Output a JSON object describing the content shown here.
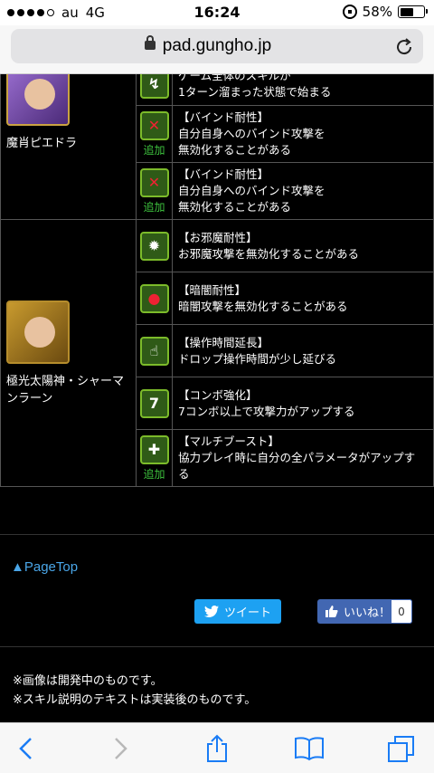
{
  "status": {
    "carrier": "au",
    "network": "4G",
    "time": "16:24",
    "battery": "58%",
    "battery_level": 0.58
  },
  "browser": {
    "url": "pad.gungho.jp"
  },
  "monsters": [
    {
      "name": "魔肖ピエドラ",
      "skills": [
        {
          "icon": "skill-boost-icon",
          "added": false,
          "title": "",
          "lines": [
            "ゲーム全体のスキルが",
            "1ターン溜まった状態で始まる"
          ]
        },
        {
          "icon": "bind-resist-icon",
          "added": true,
          "title": "【バインド耐性】",
          "lines": [
            "自分自身へのバインド攻撃を",
            "無効化することがある"
          ]
        },
        {
          "icon": "bind-resist-icon",
          "added": true,
          "title": "【バインド耐性】",
          "lines": [
            "自分自身へのバインド攻撃を",
            "無効化することがある"
          ]
        }
      ]
    },
    {
      "name": "極光太陽神・シャーマンラーン",
      "skills": [
        {
          "icon": "jammer-resist-icon",
          "added": false,
          "title": "【お邪魔耐性】",
          "lines": [
            "お邪魔攻撃を無効化することがある"
          ]
        },
        {
          "icon": "darkness-resist-icon",
          "added": false,
          "title": "【暗闇耐性】",
          "lines": [
            "暗闇攻撃を無効化することがある"
          ]
        },
        {
          "icon": "time-extend-icon",
          "added": false,
          "title": "【操作時間延長】",
          "lines": [
            "ドロップ操作時間が少し延びる"
          ]
        },
        {
          "icon": "combo-boost-icon",
          "added": false,
          "title": "【コンボ強化】",
          "lines": [
            "7コンボ以上で攻撃力がアップする"
          ]
        },
        {
          "icon": "multi-boost-icon",
          "added": true,
          "title": "【マルチブースト】",
          "lines": [
            "協力プレイ時に自分の全パラメータがアップす",
            "る"
          ]
        }
      ]
    }
  ],
  "added_label": "追加",
  "pagetop": "▲PageTop",
  "tweet_label": "ツイート",
  "like_label": "いいね！",
  "like_count": "0",
  "notes": [
    "※画像は開発中のものです。",
    "※スキル説明のテキストは実装後のものです。"
  ]
}
